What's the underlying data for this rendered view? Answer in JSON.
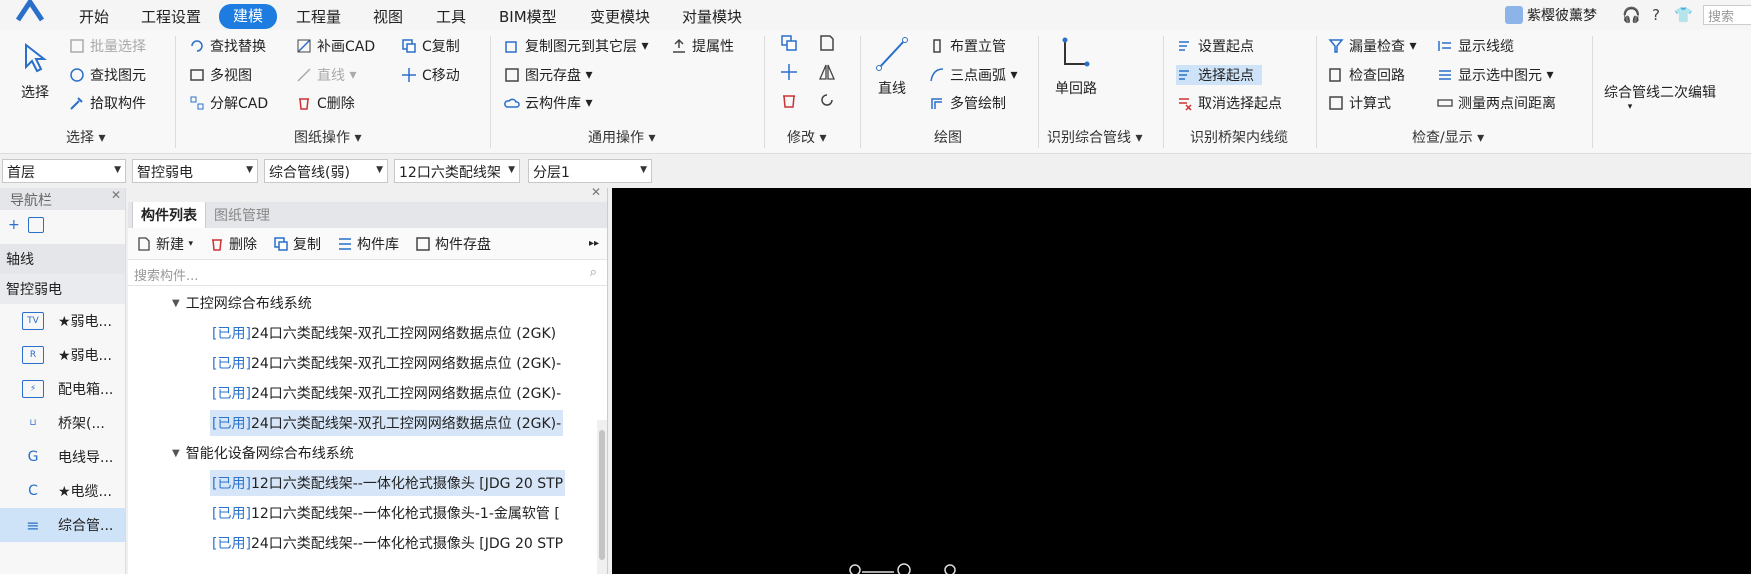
{
  "menubar": {
    "items": [
      "开始",
      "工程设置",
      "建模",
      "工程量",
      "视图",
      "工具",
      "BIM模型",
      "变更模块",
      "对量模块"
    ],
    "active": "建模",
    "user": "紫樱彼薰梦",
    "search_placeholder": "搜索"
  },
  "ribbon": {
    "select": {
      "label": "选择",
      "group": "选择"
    },
    "col1": [
      "批量选择",
      "查找图元",
      "拾取构件"
    ],
    "col2": [
      "查找替换",
      "多视图",
      "分解CAD"
    ],
    "col3": [
      "补画CAD",
      "直线",
      "C删除"
    ],
    "col4": [
      "C复制",
      "C移动"
    ],
    "drawing_ops_group": "图纸操作",
    "col5": [
      "复制图元到其它层",
      "图元存盘",
      "云构件库"
    ],
    "col6": [
      "提属性"
    ],
    "general_group": "通用操作",
    "modify_group": "修改",
    "draw": {
      "big": "直线",
      "items": [
        "布置立管",
        "三点画弧",
        "多管绘制"
      ],
      "group": "绘图"
    },
    "recognize": {
      "big": "单回路",
      "group": "识别综合管线"
    },
    "bridge": {
      "items": [
        "设置起点",
        "选择起点",
        "取消选择起点"
      ],
      "group": "识别桥架内线缆"
    },
    "check": {
      "col1": [
        "漏量检查",
        "检查回路",
        "计算式"
      ],
      "col2": [
        "显示线缆",
        "显示选中图元",
        "测量两点间距离"
      ],
      "group": "检查/显示"
    },
    "edit2": "综合管线二次编辑"
  },
  "selectors": [
    "首层",
    "智控弱电",
    "综合管线(弱)",
    "12口六类配线架",
    "分层1"
  ],
  "nav": {
    "title": "导航栏",
    "cat1": "轴线",
    "cat2": "智控弱电",
    "items": [
      {
        "icon": "TV",
        "label": "★弱电..."
      },
      {
        "icon": "R",
        "label": "★弱电..."
      },
      {
        "icon": "⚡",
        "label": "配电箱..."
      },
      {
        "icon": "⊔",
        "label": "桥架(..."
      },
      {
        "icon": "G",
        "label": "电线导..."
      },
      {
        "icon": "C",
        "label": "★电缆..."
      },
      {
        "icon": "≡",
        "label": "综合管..."
      }
    ]
  },
  "comp": {
    "tabs": [
      "构件列表",
      "图纸管理"
    ],
    "tools": [
      "新建",
      "删除",
      "复制",
      "构件库",
      "构件存盘"
    ],
    "search_placeholder": "搜索构件...",
    "tree": [
      {
        "type": "group",
        "label": "工控网综合布线系统"
      },
      {
        "type": "leaf",
        "tag": "[已用]",
        "label": " 24口六类配线架-双孔工控网网络数据点位 (2GK)",
        "active": false
      },
      {
        "type": "leaf",
        "tag": "[已用]",
        "label": " 24口六类配线架-双孔工控网网络数据点位 (2GK)-",
        "active": false
      },
      {
        "type": "leaf",
        "tag": "[已用]",
        "label": " 24口六类配线架-双孔工控网网络数据点位 (2GK)-",
        "active": false
      },
      {
        "type": "leaf",
        "tag": "[已用]",
        "label": " 24口六类配线架-双孔工控网网络数据点位 (2GK)-",
        "active": true
      },
      {
        "type": "group",
        "label": "智能化设备网综合布线系统"
      },
      {
        "type": "leaf",
        "tag": "[已用]",
        "label": " 12口六类配线架--一体化枪式摄像头 [JDG 20 STP",
        "active": true
      },
      {
        "type": "leaf",
        "tag": "[已用]",
        "label": " 12口六类配线架--一体化枪式摄像头-1-金属软管 [",
        "active": false
      },
      {
        "type": "leaf",
        "tag": "[已用]",
        "label": " 24口六类配线架--一体化枪式摄像头 [JDG 20 STP",
        "active": false
      }
    ]
  }
}
